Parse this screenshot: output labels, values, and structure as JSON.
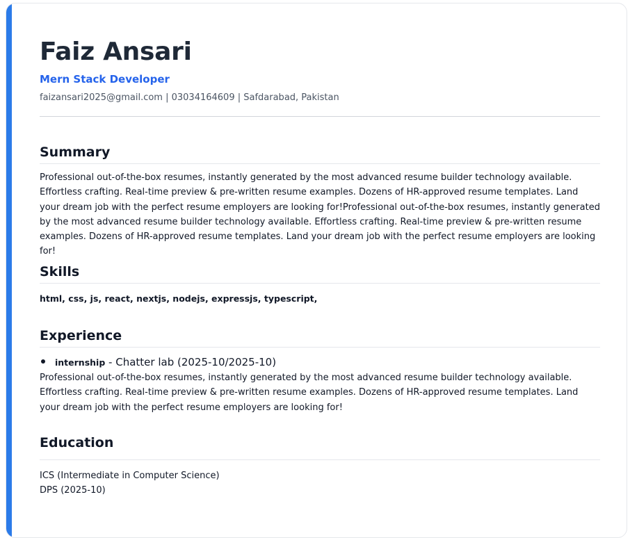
{
  "header": {
    "name": "Faiz Ansari",
    "role": "Mern Stack Developer",
    "contact": "faizansari2025@gmail.com | 03034164609 | Safdarabad, Pakistan"
  },
  "summary": {
    "title": "Summary",
    "text": "Professional out-of-the-box resumes, instantly generated by the most advanced resume builder technology available. Effortless crafting. Real-time preview & pre-written resume examples. Dozens of HR-approved resume templates. Land your dream job with the perfect resume employers are looking for!Professional out-of-the-box resumes, instantly generated by the most advanced resume builder technology available. Effortless crafting. Real-time preview & pre-written resume examples. Dozens of HR-approved resume templates. Land your dream job with the perfect resume employers are looking for!"
  },
  "skills": {
    "title": "Skills",
    "list": "html, css, js, react, nextjs, nodejs, expressjs, typescript,"
  },
  "experience": {
    "title": "Experience",
    "items": [
      {
        "role": "internship",
        "details": " - Chatter lab (2025-10/2025-10)",
        "description": "Professional out-of-the-box resumes, instantly generated by the most advanced resume builder technology available. Effortless crafting. Real-time preview & pre-written resume examples. Dozens of HR-approved resume templates. Land your dream job with the perfect resume employers are looking for!"
      }
    ]
  },
  "education": {
    "title": "Education",
    "items": [
      {
        "degree": "ICS (Intermediate in Computer Science)",
        "school_date": "DPS (2025-10)"
      }
    ]
  },
  "colors": {
    "accent": "#2b7be9",
    "role_text": "#2563eb",
    "heading": "#1f2937",
    "muted": "#4b5563"
  }
}
